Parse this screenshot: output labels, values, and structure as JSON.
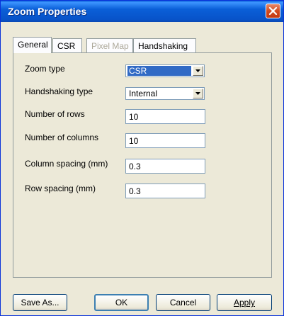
{
  "window": {
    "title": "Zoom Properties"
  },
  "tabs": [
    {
      "label": "General",
      "state": "active"
    },
    {
      "label": "CSR",
      "state": "normal"
    },
    {
      "label": "Pixel Map",
      "state": "disabled"
    },
    {
      "label": "Handshaking",
      "state": "normal"
    }
  ],
  "fields": {
    "zoom_type": {
      "label": "Zoom type",
      "value": "CSR"
    },
    "handshaking_type": {
      "label": "Handshaking type",
      "value": "Internal"
    },
    "rows": {
      "label": "Number of rows",
      "value": "10"
    },
    "columns": {
      "label": "Number of columns",
      "value": "10"
    },
    "column_spacing": {
      "label": "Column spacing (mm)",
      "value": "0.3"
    },
    "row_spacing": {
      "label": "Row spacing (mm)",
      "value": "0.3"
    }
  },
  "buttons": {
    "save_as": "Save As...",
    "ok": "OK",
    "cancel": "Cancel",
    "apply": "Apply"
  }
}
